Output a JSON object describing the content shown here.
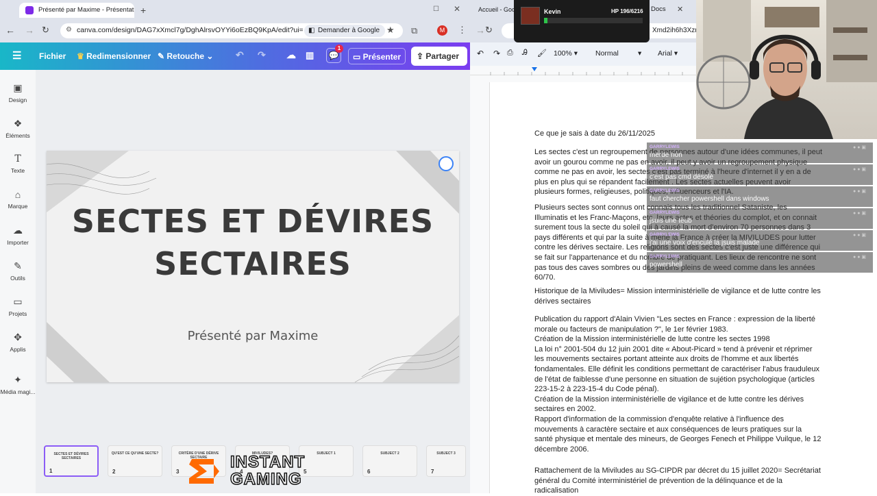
{
  "left_browser": {
    "tabs": [
      {
        "title": "Présenté par Maxime - Présentat",
        "active": true
      },
      {
        "title": "Accueil - Goo",
        "active": false
      }
    ],
    "address": "canva.com/design/DAG7xXmcl7g/DghAlrsvOYYi6oEzBQ9KpA/edit?ui=e...",
    "ask_google": "Demander à Google",
    "profile_initial": "M"
  },
  "canva": {
    "menu": {
      "file": "Fichier",
      "resize": "Redimensionner",
      "retouch": "Retouche",
      "comments_badge": "1",
      "present": "Présenter",
      "share": "Partager"
    },
    "sidebar": [
      {
        "label": "Design",
        "icon": "design-icon"
      },
      {
        "label": "Éléments",
        "icon": "elements-icon"
      },
      {
        "label": "Texte",
        "icon": "text-icon"
      },
      {
        "label": "Marque",
        "icon": "brand-icon"
      },
      {
        "label": "Importer",
        "icon": "upload-icon"
      },
      {
        "label": "Outils",
        "icon": "tools-icon"
      },
      {
        "label": "Projets",
        "icon": "folder-icon"
      },
      {
        "label": "Applis",
        "icon": "apps-icon"
      },
      {
        "label": "Média magi...",
        "icon": "magic-media-icon"
      }
    ],
    "slide": {
      "title": "SECTES ET DÉVIRES SECTAIRES",
      "subtitle": "Présenté par Maxime"
    },
    "thumbnails": [
      {
        "num": "1",
        "text": "SECTES ET DÉVIRES SECTAIRES"
      },
      {
        "num": "2",
        "text": "QU'EST CE QU'UNE SECTE?"
      },
      {
        "num": "3",
        "text": "CRITÈRE D'UNE DÉRIVE SECTAIRE"
      },
      {
        "num": "4",
        "text": "MIVILUDES?"
      },
      {
        "num": "5",
        "text": "SUBJECT 1"
      },
      {
        "num": "6",
        "text": "SUBJECT 2"
      },
      {
        "num": "7",
        "text": "SUBJECT 3"
      }
    ]
  },
  "right_browser": {
    "tab": "Docs",
    "address_fragment": "Xmd2ih6h3Xzn"
  },
  "gdocs": {
    "zoom": "100%",
    "style": "Normal",
    "font": "Arial",
    "paragraphs": [
      "Ce que je sais à date du 26/11/2025",
      "Les sectes c'est un regroupement de personnes autour d'une idées communes, il peut avoir un gourou comme ne pas en avoir, il peut y avoir un regroupement physique comme ne pas en avoir, les sectes c'est pas terminé à l'heure d'internet il y en a de plus en plus qui se répandent facilement . Les sectes actuelles peuvent avoir plusieurs formes, religieuses, politiques, influenceurs et l'IA.",
      "Plusieurs sectes sont connus ont connais tous les traditionnel Sataniste, les Illuminatis et les Franc-Maçons, etc, leurs actes et théories du complot, et on connait surement tous la secte du soleil qui à causé la mort d'environ 70 personnes dans 3 pays différents et qui par la suite à mené la France à créer la MIVILUDES pour lutter contre les dérives sectaire. Les religions sont des sectes c'est juste une différence qui se fait sur l'appartenance et du nombre de pratiquant. Les lieux de rencontre ne sont pas tous des caves sombres ou des jardins pleins de weed comme dans les années 60/70.",
      "Historique de la Miviludes= Mission interministérielle de vigilance et de lutte contre les dérives sectaires",
      "Publication du rapport d'Alain Vivien \"Les sectes en France : expression de la liberté morale ou facteurs de manipulation ?\", le 1er février 1983.\nCréation de la Mission interministérielle de lutte contre les sectes 1998\nLa loi n° 2001-504 du 12 juin 2001 dite « About-Picard » tend à prévenir et réprimer les mouvements sectaires portant atteinte aux droits de l'homme et aux libertés fondamentales.  Elle définit les conditions permettant de caractériser l'abus frauduleux de l'état de faiblesse d'une personne en situation de sujétion psychologique (articles 223-15-2 à 223-15-4 du Code pénal).\nCréation de la Mission interministérielle de vigilance et de lutte contre les dérives sectaires en 2002.\nRapport d'information de la commission d'enquête relative à l'influence des mouvements à caractère sectaire et aux conséquences de leurs pratiques sur la santé physique et mentale des mineurs, de Georges Fenech et Philippe Vuilque, le 12 décembre 2006.",
      "Rattachement de la Miviludes au SG-CIPDR par décret du 15 juillet 2020= Secrétariat général du Comité interministériel de prévention de la délinquance et de la radicalisation"
    ]
  },
  "hp_overlay": {
    "name": "Kevin",
    "hp": "HP 196/6216",
    "hp_fraction": 0.032
  },
  "chat": [
    {
      "user": "GARRYLEWIS",
      "message": "merde non"
    },
    {
      "user": "GARRYLEWIS",
      "message": "c'est pas cmd désolé"
    },
    {
      "user": "GARRYLEWIS",
      "message": "faut chercher powershell dans windows"
    },
    {
      "user": "GARRYLEWIS",
      "message": "jsuis une teub"
    },
    {
      "user": "GARRYLEWIS",
      "message": "j'ai une voix d'enculé la jsuis malade"
    },
    {
      "user": "GARRYLEWIS",
      "message": "powershell"
    }
  ],
  "sponsor_logo": {
    "line1": "INSTANT",
    "line2": "GAMING"
  },
  "colors": {
    "canva_gradient_start": "#19b7c8",
    "canva_gradient_end": "#7b3cf0",
    "chat_user": "#d6b4ff",
    "hp_bar": "#2ec44a"
  }
}
